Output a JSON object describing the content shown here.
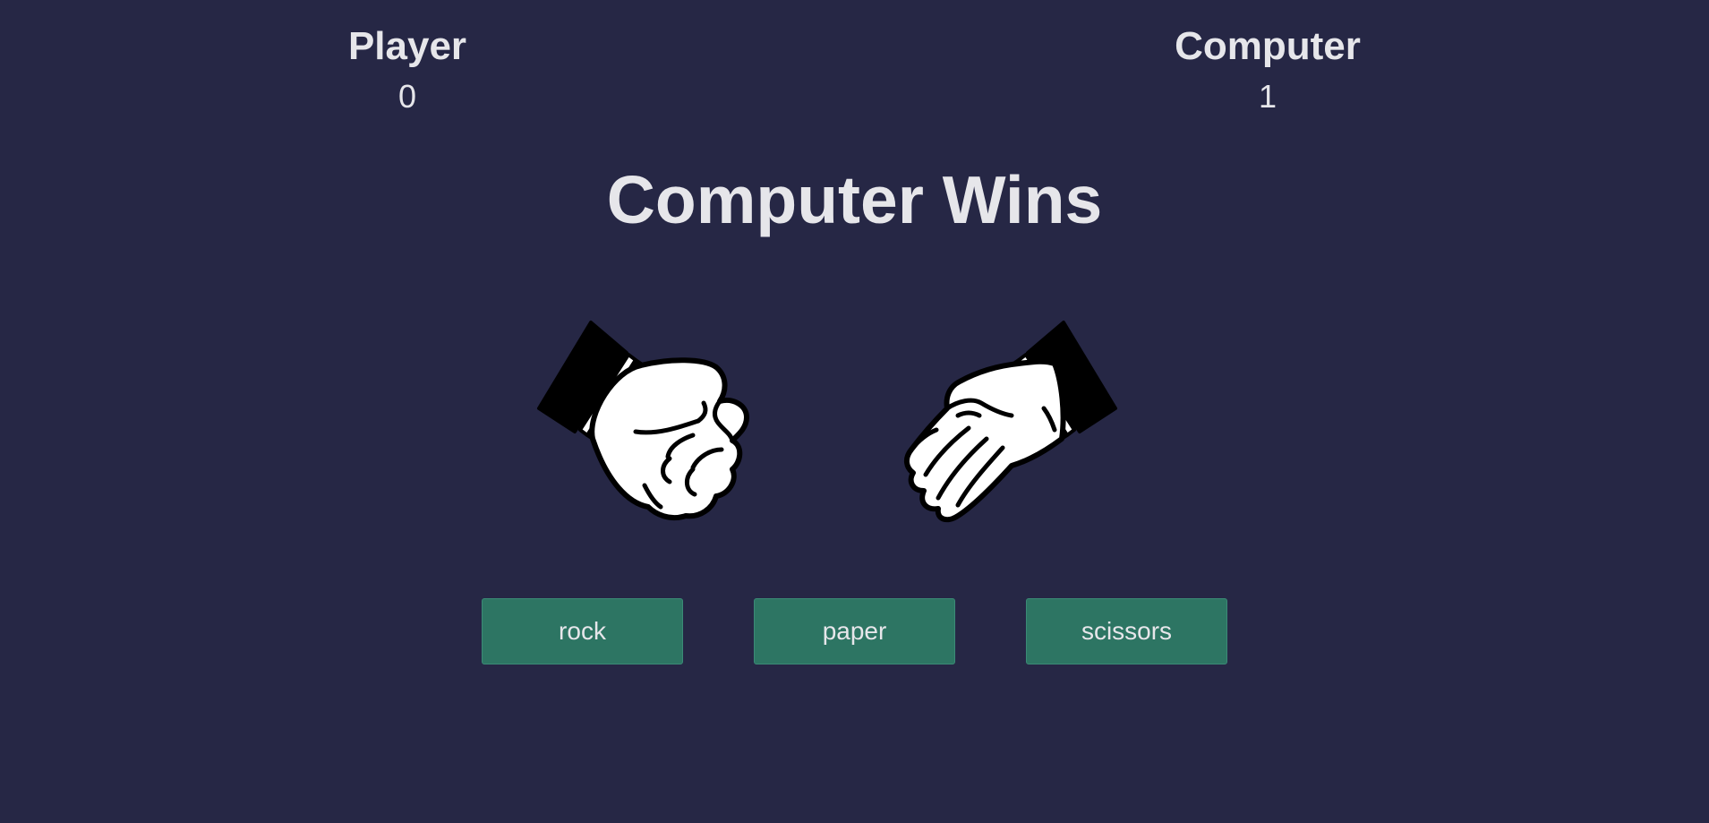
{
  "scoreboard": {
    "player": {
      "label": "Player",
      "score": "0"
    },
    "computer": {
      "label": "Computer",
      "score": "1"
    }
  },
  "result": "Computer Wins",
  "hands": {
    "player": {
      "choice": "rock",
      "icon": "fist-hand-icon"
    },
    "computer": {
      "choice": "paper",
      "icon": "open-hand-icon"
    }
  },
  "buttons": [
    {
      "label": "rock"
    },
    {
      "label": "paper"
    },
    {
      "label": "scissors"
    }
  ],
  "colors": {
    "background": "#262745",
    "text": "#e6e6ea",
    "button": "#2d7563"
  }
}
